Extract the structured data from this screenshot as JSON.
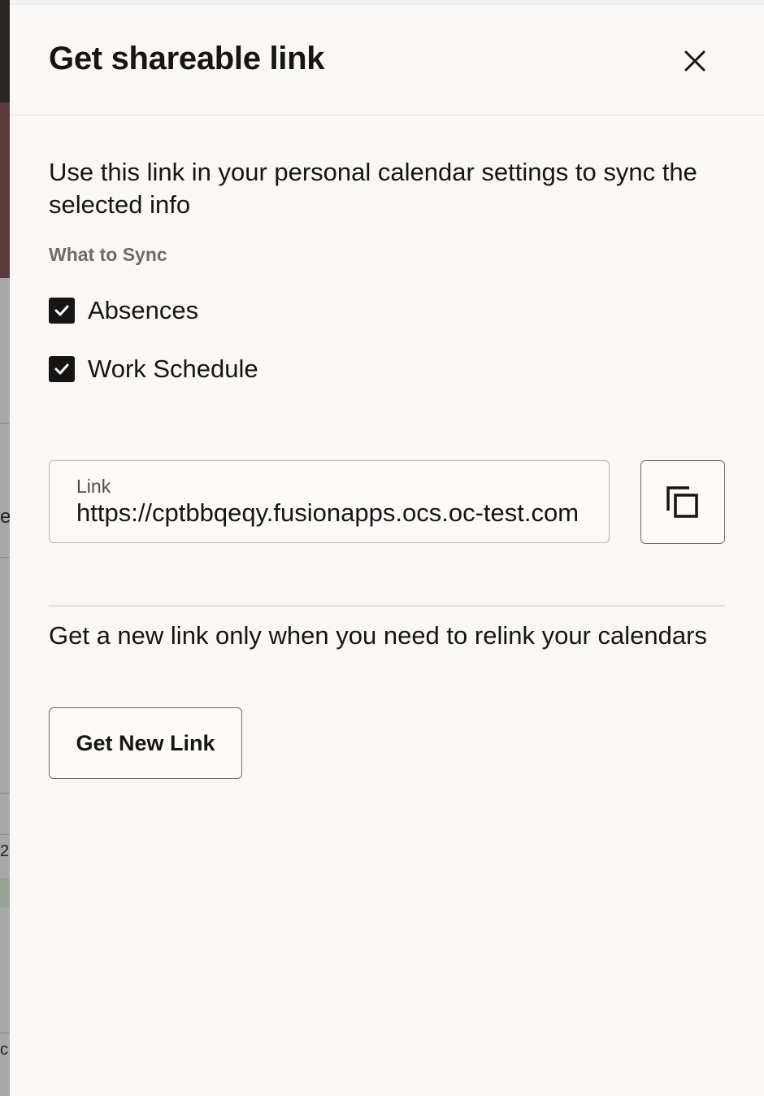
{
  "backdrop": {
    "frag_e": "e",
    "frag_2": "2",
    "frag_c": "c"
  },
  "dialog": {
    "title": "Get shareable link",
    "close_icon": "close-icon",
    "intro_text": "Use this link in your personal calendar settings to sync the selected info",
    "sync_section": {
      "label": "What to Sync",
      "options": [
        {
          "label": "Absences",
          "checked": true
        },
        {
          "label": "Work Schedule",
          "checked": true
        }
      ]
    },
    "link_field": {
      "label": "Link",
      "value": "https://cptbbqeqy.fusionapps.ocs.oc-test.com"
    },
    "copy_button_icon": "copy-icon",
    "relink_text": "Get a new link only when you need to relink your calendars",
    "new_link_button": "Get New Link"
  }
}
